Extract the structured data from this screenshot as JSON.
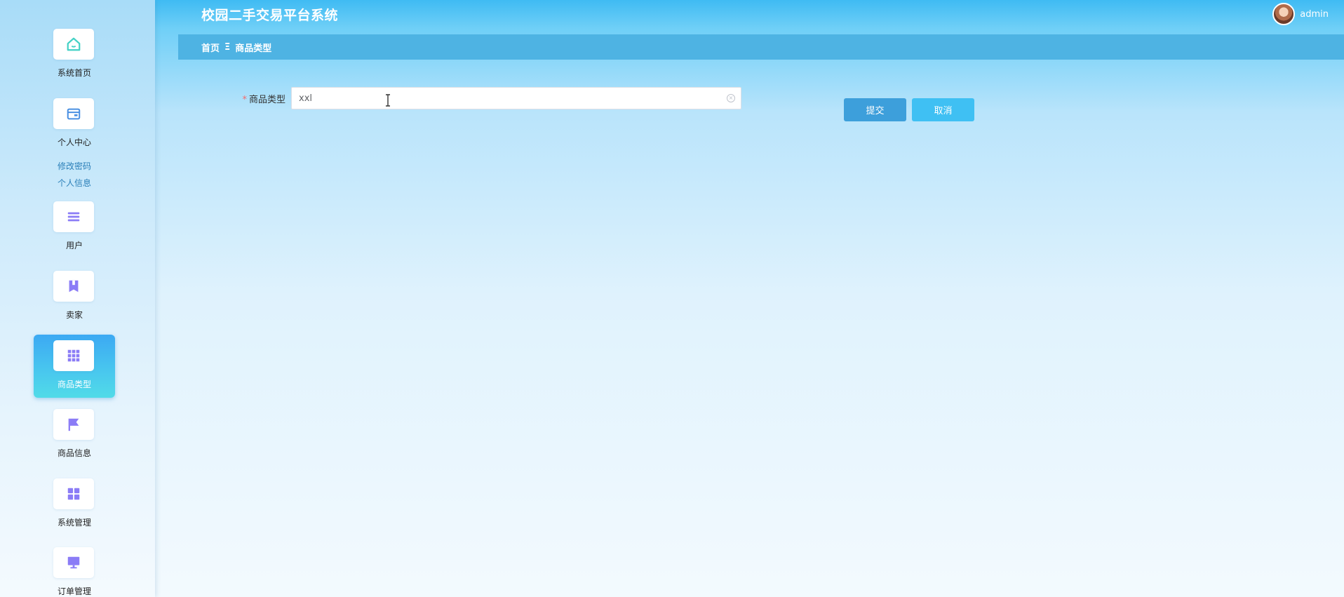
{
  "header": {
    "app_title": "校园二手交易平台系统",
    "username": "admin"
  },
  "breadcrumb": {
    "home": "首页",
    "separator": "Ξ",
    "current": "商品类型"
  },
  "sidebar": {
    "items": [
      {
        "label": "系统首页",
        "icon": "home-icon"
      },
      {
        "label": "个人中心",
        "icon": "wallet-icon",
        "sub_items": [
          "修改密码",
          "个人信息"
        ]
      },
      {
        "label": "用户",
        "icon": "list-icon"
      },
      {
        "label": "卖家",
        "icon": "bookmark-icon"
      },
      {
        "label": "商品类型",
        "icon": "grid-icon",
        "active": true
      },
      {
        "label": "商品信息",
        "icon": "flag-icon"
      },
      {
        "label": "系统管理",
        "icon": "apps-icon"
      },
      {
        "label": "订单管理",
        "icon": "monitor-icon"
      }
    ]
  },
  "form": {
    "required_mark": "*",
    "field_label": "商品类型",
    "field_value": "xxl",
    "submit_label": "提交",
    "cancel_label": "取消"
  },
  "colors": {
    "accent": "#3fbbf3",
    "breadcrumb_bg": "#4eb3e3",
    "submit_bg": "#3d9fdb",
    "cancel_bg": "#3fc0f3",
    "icon_color": "#8b7cf6",
    "home_icon_color": "#43d1c5"
  }
}
